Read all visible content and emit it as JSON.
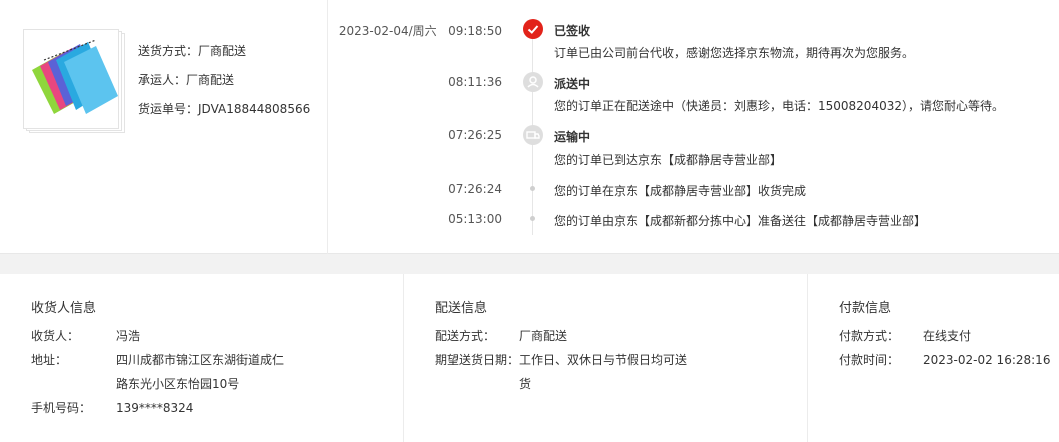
{
  "goods": {
    "delivery_label": "送货方式：",
    "delivery_value": "厂商配送",
    "carrier_label": "承运人：",
    "carrier_value": "厂商配送",
    "waybill_label": "货运单号：",
    "waybill_value": "JDVA18844808566",
    "thumbnail_icon": "product-thumbnail"
  },
  "timeline": {
    "events": [
      {
        "date": "2023-02-04/周六",
        "time": "09:18:50",
        "title": "已签收",
        "desc": "订单已由公司前台代收，感谢您选择京东物流，期待再次为您服务。",
        "icon": "check-icon",
        "state": "current"
      },
      {
        "date": "",
        "time": "08:11:36",
        "title": "派送中",
        "desc": "您的订单正在配送途中（快递员：刘惠珍，电话：15008204032），请您耐心等待。",
        "icon": "courier-icon",
        "state": "past"
      },
      {
        "date": "",
        "time": "07:26:25",
        "title": "运输中",
        "desc": "您的订单已到达京东【成都静居寺营业部】",
        "icon": "truck-icon",
        "state": "past"
      },
      {
        "date": "",
        "time": "07:26:24",
        "title": "",
        "desc": "您的订单在京东【成都静居寺营业部】收货完成",
        "icon": "dot",
        "state": "past"
      },
      {
        "date": "",
        "time": "05:13:00",
        "title": "",
        "desc": "您的订单由京东【成都新都分拣中心】准备送往【成都静居寺营业部】",
        "icon": "dot",
        "state": "past"
      }
    ]
  },
  "receiver": {
    "heading": "收货人信息",
    "name_label": "收货人：",
    "name_value": "冯浩",
    "address_label": "地址：",
    "address_line1": "四川成都市锦江区东湖街道成仁",
    "address_line2": "路东光小区东怡园10号",
    "phone_label": "手机号码：",
    "phone_value": "139****8324"
  },
  "shipping": {
    "heading": "配送信息",
    "method_label": "配送方式：",
    "method_value": "厂商配送",
    "expected_label": "期望送货日期：",
    "expected_line1": "工作日、双休日与节假日均可送",
    "expected_line2": "货"
  },
  "payment": {
    "heading": "付款信息",
    "method_label": "付款方式：",
    "method_value": "在线支付",
    "time_label": "付款时间：",
    "time_value": "2023-02-02 16:28:16"
  },
  "colors": {
    "accent": "#e2231a",
    "inactive_icon": "#dedede",
    "page_bg": "#f2f2f2"
  }
}
